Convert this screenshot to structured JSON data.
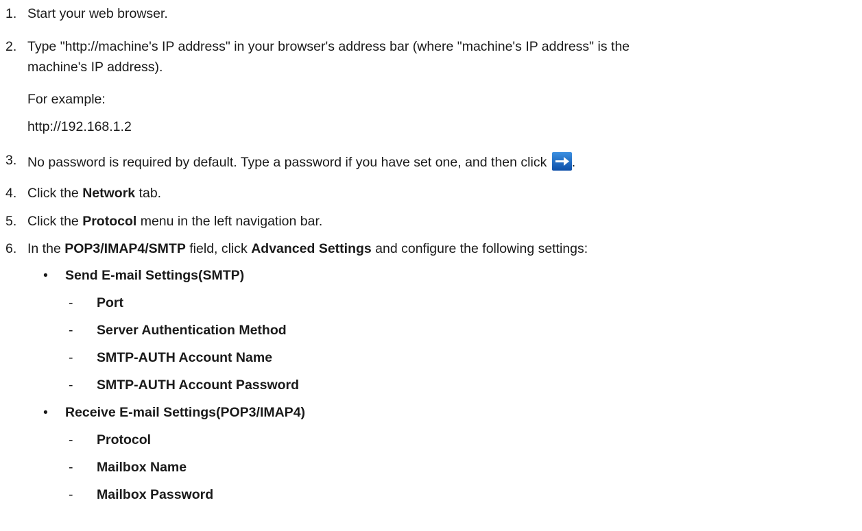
{
  "steps": [
    {
      "num": "1.",
      "text": "Start your web browser."
    },
    {
      "num": "2.",
      "line1": "Type \"http://machine's IP address\" in your browser's address bar (where \"machine's IP address\" is the",
      "line2": "machine's IP address).",
      "example_label": "For example:",
      "example_value": "http://192.168.1.2"
    },
    {
      "num": "3.",
      "text": "No password is required by default. Type a password if you have set one, and then click ",
      "after_icon": "."
    },
    {
      "num": "4.",
      "pre": "Click the ",
      "bold": "Network",
      "post": " tab."
    },
    {
      "num": "5.",
      "pre": "Click the ",
      "bold": "Protocol",
      "post": " menu in the left navigation bar."
    },
    {
      "num": "6.",
      "pre": "In the ",
      "bold1": "POP3/IMAP4/SMTP",
      "mid": " field, click ",
      "bold2": "Advanced Settings",
      "post": " and configure the following settings:"
    }
  ],
  "settings": [
    {
      "bullet": "•",
      "title": "Send E-mail Settings(SMTP)",
      "items": [
        "Port",
        "Server Authentication Method",
        "SMTP-AUTH Account Name",
        "SMTP-AUTH Account Password"
      ]
    },
    {
      "bullet": "•",
      "title": "Receive E-mail Settings(POP3/IMAP4)",
      "items": [
        "Protocol",
        "Mailbox Name",
        "Mailbox Password"
      ]
    }
  ],
  "dash": "-",
  "icons": {
    "step3_icon": "arrow-right-icon",
    "icon_bg": "#1565c0"
  }
}
